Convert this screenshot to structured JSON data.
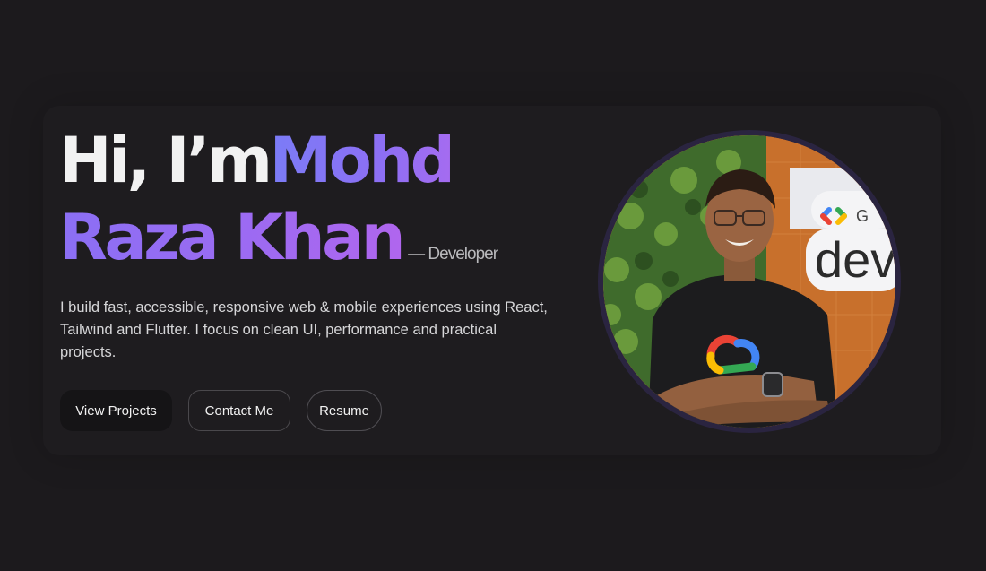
{
  "hero": {
    "greeting": "Hi, I’m",
    "name_line1": "Mohd",
    "name_line2": "Raza Khan",
    "role": "— Developer",
    "bio": "I build fast, accessible, responsive web & mobile experiences using React, Tailwind and Flutter. I focus on clean UI, performance and practical projects.",
    "buttons": {
      "view_projects": "View Projects",
      "contact": "Contact Me",
      "resume": "Resume"
    }
  },
  "photo": {
    "sign_text": "dev",
    "sign_prefix": "G"
  },
  "colors": {
    "background": "#1c1a1d",
    "accent_start": "#7b7cf6",
    "accent_end": "#b066ee"
  }
}
